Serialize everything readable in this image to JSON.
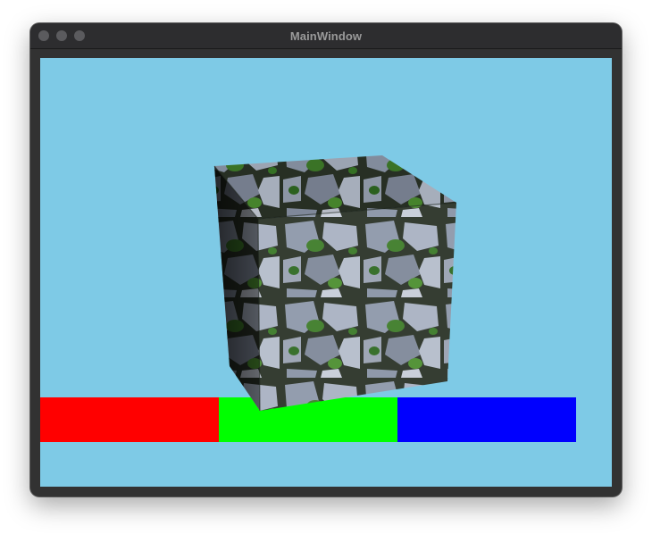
{
  "window": {
    "title": "MainWindow"
  },
  "scene": {
    "background_color": "#7ecae6",
    "bars": [
      {
        "name": "red",
        "color": "#ff0000"
      },
      {
        "name": "green",
        "color": "#00ff00"
      },
      {
        "name": "blue",
        "color": "#0000ff"
      }
    ],
    "cube": {
      "texture": "mossy-cobblestone"
    }
  }
}
